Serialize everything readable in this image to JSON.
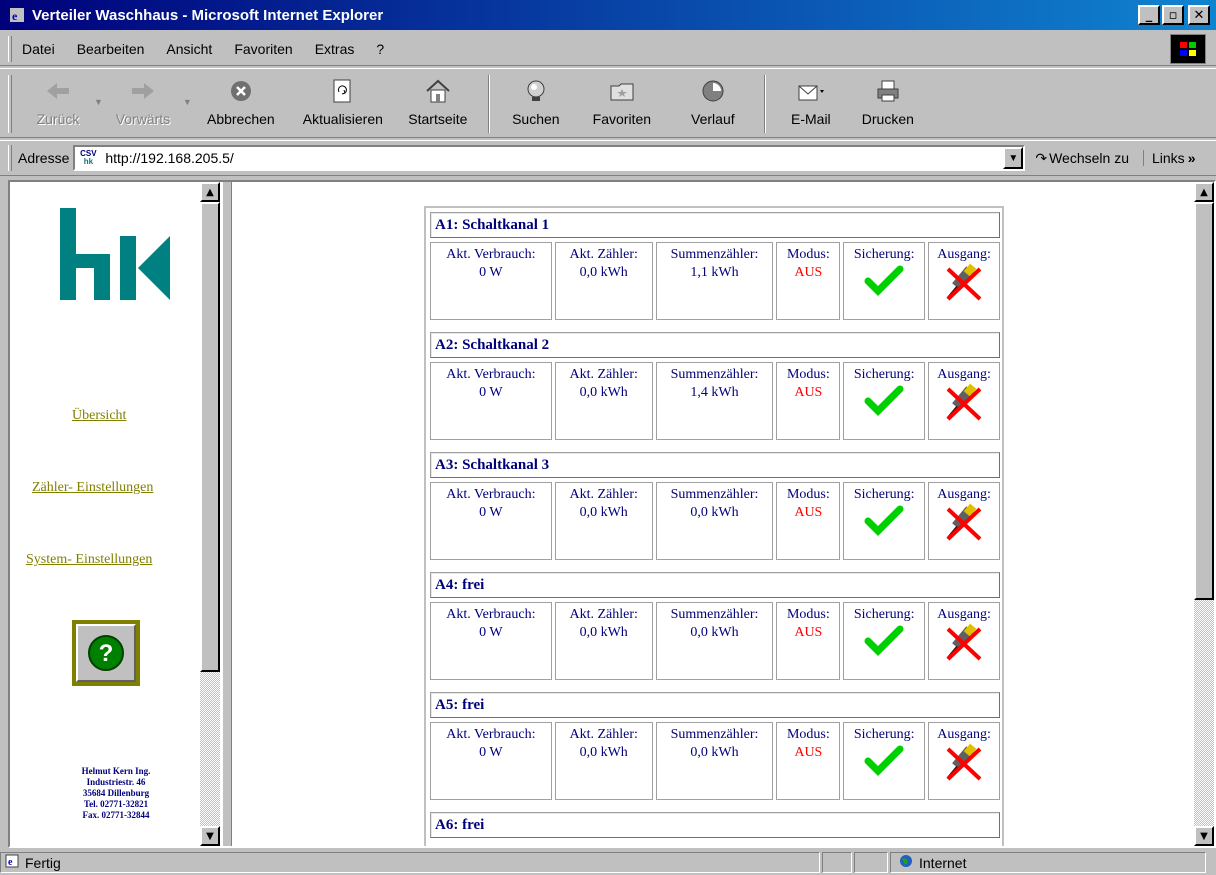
{
  "window": {
    "title": "Verteiler Waschhaus - Microsoft Internet Explorer"
  },
  "menu": [
    "Datei",
    "Bearbeiten",
    "Ansicht",
    "Favoriten",
    "Extras",
    "?"
  ],
  "toolbar": {
    "back": "Zurück",
    "forward": "Vorwärts",
    "stop": "Abbrechen",
    "refresh": "Aktualisieren",
    "home": "Startseite",
    "search": "Suchen",
    "favorites": "Favoriten",
    "history": "Verlauf",
    "mail": "E-Mail",
    "print": "Drucken"
  },
  "address": {
    "label": "Adresse",
    "url": "http://192.168.205.5/",
    "go": "Wechseln zu",
    "links": "Links"
  },
  "favicon": {
    "top": "CSV",
    "bottom": "hk"
  },
  "sidebar": {
    "logo_text": "hk",
    "nav": [
      "Übersicht",
      "Zähler- Einstellungen",
      "System- Einstellungen"
    ],
    "help_symbol": "?",
    "company": [
      "Helmut Kern Ing.",
      "Industriestr. 46",
      "35684 Dillenburg",
      "Tel. 02771-32821",
      "Fax. 02771-32844"
    ]
  },
  "labels": {
    "verbrauch": "Akt. Verbrauch:",
    "zaehler": "Akt. Zähler:",
    "summe": "Summenzähler:",
    "modus": "Modus:",
    "sicherung": "Sicherung:",
    "ausgang": "Ausgang:"
  },
  "channels": [
    {
      "title": "A1: Schaltkanal 1",
      "verbrauch": "0 W",
      "zaehler": "0,0 kWh",
      "summe": "1,1 kWh",
      "modus": "AUS",
      "sicherung": "ok",
      "ausgang": "off"
    },
    {
      "title": "A2: Schaltkanal 2",
      "verbrauch": "0 W",
      "zaehler": "0,0 kWh",
      "summe": "1,4 kWh",
      "modus": "AUS",
      "sicherung": "ok",
      "ausgang": "off"
    },
    {
      "title": "A3: Schaltkanal 3",
      "verbrauch": "0 W",
      "zaehler": "0,0 kWh",
      "summe": "0,0 kWh",
      "modus": "AUS",
      "sicherung": "ok",
      "ausgang": "off"
    },
    {
      "title": "A4: frei",
      "verbrauch": "0 W",
      "zaehler": "0,0 kWh",
      "summe": "0,0 kWh",
      "modus": "AUS",
      "sicherung": "ok",
      "ausgang": "off"
    },
    {
      "title": "A5: frei",
      "verbrauch": "0 W",
      "zaehler": "0,0 kWh",
      "summe": "0,0 kWh",
      "modus": "AUS",
      "sicherung": "ok",
      "ausgang": "off"
    },
    {
      "title": "A6: frei"
    }
  ],
  "status": {
    "text": "Fertig",
    "zone": "Internet"
  },
  "colors": {
    "titlebar": "#00007b",
    "link": "#808000",
    "text": "#00007b",
    "aus": "#ff0000",
    "check": "#00d000",
    "logo": "#008080"
  }
}
